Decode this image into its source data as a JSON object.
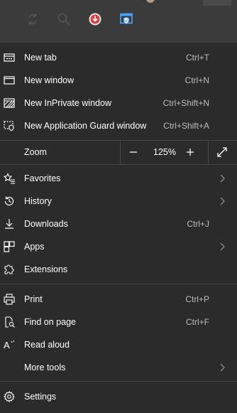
{
  "toolbar": {
    "icons": [
      "refresh-icon",
      "search-icon",
      "download-badge-icon",
      "app-guard-icon"
    ]
  },
  "menu": {
    "new_tab": {
      "label": "New tab",
      "shortcut": "Ctrl+T"
    },
    "new_window": {
      "label": "New window",
      "shortcut": "Ctrl+N"
    },
    "new_inprivate": {
      "label": "New InPrivate window",
      "shortcut": "Ctrl+Shift+N"
    },
    "new_app_guard": {
      "label": "New Application Guard window",
      "shortcut": "Ctrl+Shift+A"
    },
    "zoom": {
      "label": "Zoom",
      "value": "125%",
      "minus": "−",
      "plus": "+"
    },
    "favorites": {
      "label": "Favorites"
    },
    "history": {
      "label": "History"
    },
    "downloads": {
      "label": "Downloads",
      "shortcut": "Ctrl+J"
    },
    "apps": {
      "label": "Apps"
    },
    "extensions": {
      "label": "Extensions"
    },
    "print": {
      "label": "Print",
      "shortcut": "Ctrl+P"
    },
    "find_on_page": {
      "label": "Find on page",
      "shortcut": "Ctrl+F"
    },
    "read_aloud": {
      "label": "Read aloud"
    },
    "more_tools": {
      "label": "More tools"
    },
    "settings": {
      "label": "Settings"
    }
  },
  "colors": {
    "menu_background": "#2b2b2b",
    "toolbar_background": "#3b3b3b",
    "separator": "#474747",
    "shortcut_text": "#bdbdbd",
    "download_badge": "#e23b3b"
  }
}
